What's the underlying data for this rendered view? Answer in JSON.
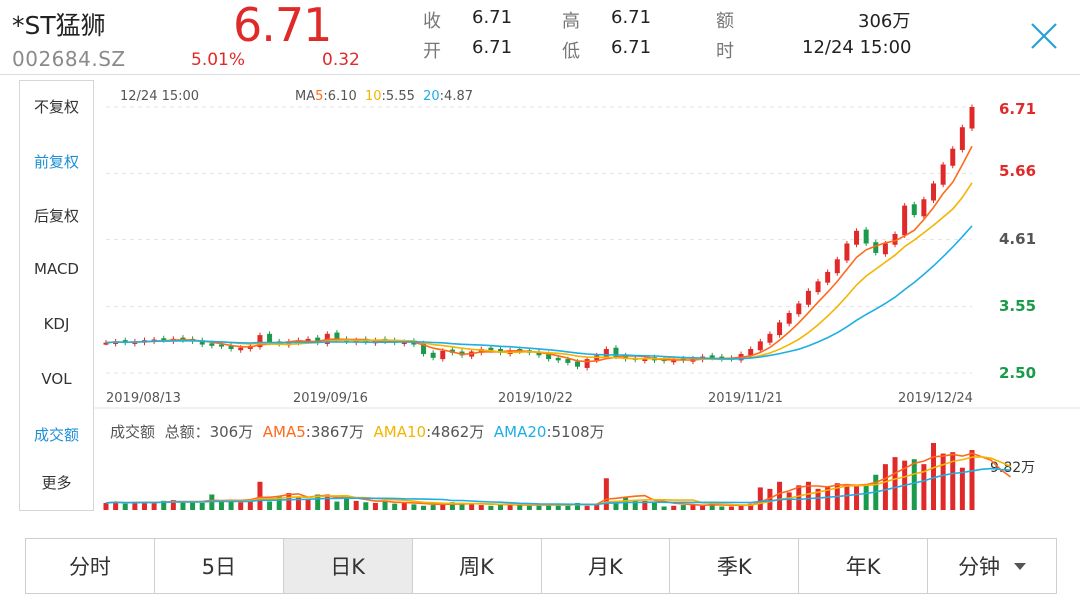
{
  "stock": {
    "name": "*ST猛狮",
    "code": "002684.SZ",
    "price": "6.71",
    "change_pct": "5.01%",
    "change": "0.32"
  },
  "quote": {
    "close_label": "收",
    "close_value": "6.71",
    "open_label": "开",
    "open_value": "6.71",
    "high_label": "高",
    "high_value": "6.71",
    "low_label": "低",
    "low_value": "6.71",
    "amount_label": "额",
    "amount_value": "306万",
    "time_label": "时",
    "time_value": "12/24 15:00"
  },
  "menu": [
    {
      "label": "不复权",
      "active": false
    },
    {
      "label": "前复权",
      "active": true
    },
    {
      "label": "后复权",
      "active": false
    },
    {
      "label": "MACD",
      "active": false
    },
    {
      "label": "KDJ",
      "active": false
    },
    {
      "label": "VOL",
      "active": false
    },
    {
      "label": "成交额",
      "active": true
    },
    {
      "label": "更多",
      "active": false
    }
  ],
  "kline": {
    "time": "12/24 15:00",
    "ma5_prefix": "MA",
    "ma5_num": "5",
    "ma5_value": ":6.10",
    "ma10_num": "10",
    "ma10_value": ":5.55",
    "ma20_num": "20",
    "ma20_value": ":4.87",
    "y_labels": [
      "6.71",
      "5.66",
      "4.61",
      "3.55",
      "2.50"
    ],
    "x_labels": [
      "2019/08/13",
      "2019/09/16",
      "2019/10/22",
      "2019/11/21",
      "2019/12/24"
    ]
  },
  "volume": {
    "title": "成交额",
    "total_label": "总额：306万",
    "ama5_prefix": "AMA",
    "ama5_num": "5",
    "ama5_value": ":3867万",
    "ama10_num": "10",
    "ama10_value": ":4862万",
    "ama20_num": "20",
    "ama20_value": ":5108万",
    "max_label": "9.82万"
  },
  "tabs": [
    {
      "label": "分时",
      "active": false
    },
    {
      "label": "5日",
      "active": false
    },
    {
      "label": "日K",
      "active": true
    },
    {
      "label": "周K",
      "active": false
    },
    {
      "label": "月K",
      "active": false
    },
    {
      "label": "季K",
      "active": false
    },
    {
      "label": "年K",
      "active": false
    },
    {
      "label": "分钟",
      "active": false,
      "dropdown": true
    }
  ],
  "colors": {
    "up": "#e02a2a",
    "down": "#1a9a4a",
    "ma5": "#ff6a1a",
    "ma10": "#f5b400",
    "ma20": "#1eaee6",
    "accent": "#1e8fd6"
  },
  "chart_data": [
    {
      "type": "candlestick",
      "y_axis_ticks": [
        6.71,
        5.66,
        4.61,
        3.55,
        2.5
      ],
      "x_ticks": [
        "2019/08/13",
        "2019/09/16",
        "2019/10/22",
        "2019/11/21",
        "2019/12/24"
      ],
      "ylim": [
        2.5,
        6.71
      ],
      "series": [
        {
          "name": "MA5",
          "last": 6.1
        },
        {
          "name": "MA10",
          "last": 5.55
        },
        {
          "name": "MA20",
          "last": 4.87
        }
      ],
      "close": [
        2.98,
        3.0,
        2.98,
        3.0,
        3.02,
        3.03,
        3.02,
        3.04,
        3.02,
        3.0,
        2.95,
        2.93,
        2.92,
        2.88,
        2.9,
        2.93,
        3.1,
        2.98,
        2.96,
        3.0,
        3.02,
        3.04,
        2.98,
        3.12,
        3.02,
        3.0,
        3.02,
        2.99,
        3.02,
        3.0,
        2.98,
        2.99,
        2.95,
        2.8,
        2.74,
        2.85,
        2.82,
        2.78,
        2.84,
        2.88,
        2.86,
        2.82,
        2.86,
        2.84,
        2.82,
        2.78,
        2.72,
        2.7,
        2.66,
        2.6,
        2.72,
        2.78,
        2.88,
        2.76,
        2.72,
        2.71,
        2.73,
        2.7,
        2.69,
        2.71,
        2.7,
        2.73,
        2.76,
        2.74,
        2.72,
        2.72,
        2.8,
        2.88,
        3.0,
        3.12,
        3.3,
        3.45,
        3.6,
        3.8,
        3.95,
        4.1,
        4.3,
        4.55,
        4.75,
        4.55,
        4.4,
        4.55,
        4.7,
        5.15,
        5.0,
        5.25,
        5.5,
        5.8,
        6.05,
        6.39,
        6.71
      ]
    },
    {
      "type": "bar",
      "series": [
        {
          "name": "AMA5",
          "last": "3867万"
        },
        {
          "name": "AMA10",
          "last": "4862万"
        },
        {
          "name": "AMA20",
          "last": "5108万"
        }
      ],
      "max_label": "9.82万",
      "values": [
        10,
        12,
        9,
        11,
        12,
        10,
        13,
        14,
        11,
        12,
        10,
        22,
        12,
        13,
        11,
        14,
        40,
        12,
        20,
        24,
        18,
        16,
        22,
        22,
        12,
        17,
        13,
        11,
        10,
        12,
        9,
        11,
        8,
        6,
        7,
        9,
        11,
        10,
        8,
        7,
        6,
        9,
        8,
        7,
        6,
        6,
        8,
        9,
        7,
        10,
        6,
        9,
        45,
        13,
        18,
        13,
        13,
        12,
        5,
        6,
        7,
        8,
        7,
        9,
        5,
        5,
        7,
        9,
        32,
        30,
        40,
        25,
        35,
        40,
        30,
        34,
        38,
        37,
        36,
        35,
        50,
        65,
        75,
        70,
        72,
        65,
        95,
        80,
        82,
        60,
        85,
        70,
        55,
        15,
        10
      ]
    }
  ]
}
